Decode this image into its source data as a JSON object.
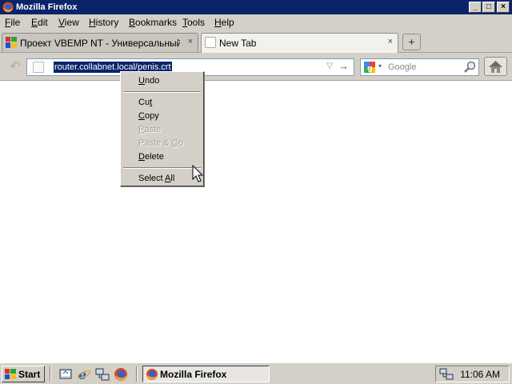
{
  "window": {
    "title": "Mozilla Firefox",
    "controls": {
      "minimize": "_",
      "maximize": "□",
      "close": "×"
    }
  },
  "menubar": {
    "items": [
      {
        "label": "File",
        "key": "F",
        "rest": "ile"
      },
      {
        "label": "Edit",
        "key": "E",
        "rest": "dit"
      },
      {
        "label": "View",
        "key": "V",
        "rest": "iew"
      },
      {
        "label": "History",
        "key": "H",
        "rest": "istory"
      },
      {
        "label": "Bookmarks",
        "key": "B",
        "rest": "ookmarks"
      },
      {
        "label": "Tools",
        "key": "T",
        "rest": "ools"
      },
      {
        "label": "Help",
        "key": "H",
        "rest": "elp"
      }
    ]
  },
  "tabs": [
    {
      "label": "Проект VBEMP NT - Универсальный VE...",
      "close": "×",
      "active": false
    },
    {
      "label": "New Tab",
      "close": "×",
      "active": true
    }
  ],
  "new_tab_symbol": "+",
  "navbar": {
    "url": "router.collabnet.local/penis.crt",
    "url_dropdown_symbol": "▽",
    "go_symbol": "→",
    "back_symbol": "↶",
    "search_placeholder": "Google",
    "search_dropdown_symbol": "▾"
  },
  "context_menu": {
    "items": [
      {
        "label": "Undo",
        "key": "U",
        "rest": "ndo",
        "enabled": true
      },
      {
        "separator": true
      },
      {
        "label": "Cut",
        "pre": "Cu",
        "key": "t",
        "rest": "",
        "enabled": true
      },
      {
        "label": "Copy",
        "key": "C",
        "rest": "opy",
        "enabled": true
      },
      {
        "label": "Paste",
        "key": "P",
        "rest": "aste",
        "enabled": false
      },
      {
        "label": "Paste & Go",
        "pre": "Paste & ",
        "key": "G",
        "rest": "o",
        "enabled": false
      },
      {
        "label": "Delete",
        "key": "D",
        "rest": "elete",
        "enabled": true
      },
      {
        "separator": true
      },
      {
        "label": "Select All",
        "pre": "Select ",
        "key": "A",
        "rest": "ll",
        "enabled": true
      }
    ]
  },
  "taskbar": {
    "start_label": "Start",
    "task_label": "Mozilla Firefox",
    "clock": "11:06 AM",
    "quicklaunch": [
      "show-desktop-icon",
      "internet-explorer-icon",
      "network-icon",
      "firefox-icon"
    ]
  },
  "colors": {
    "titlebar": "#0a246a",
    "face": "#d4d0c8",
    "selection": "#0a246a"
  }
}
